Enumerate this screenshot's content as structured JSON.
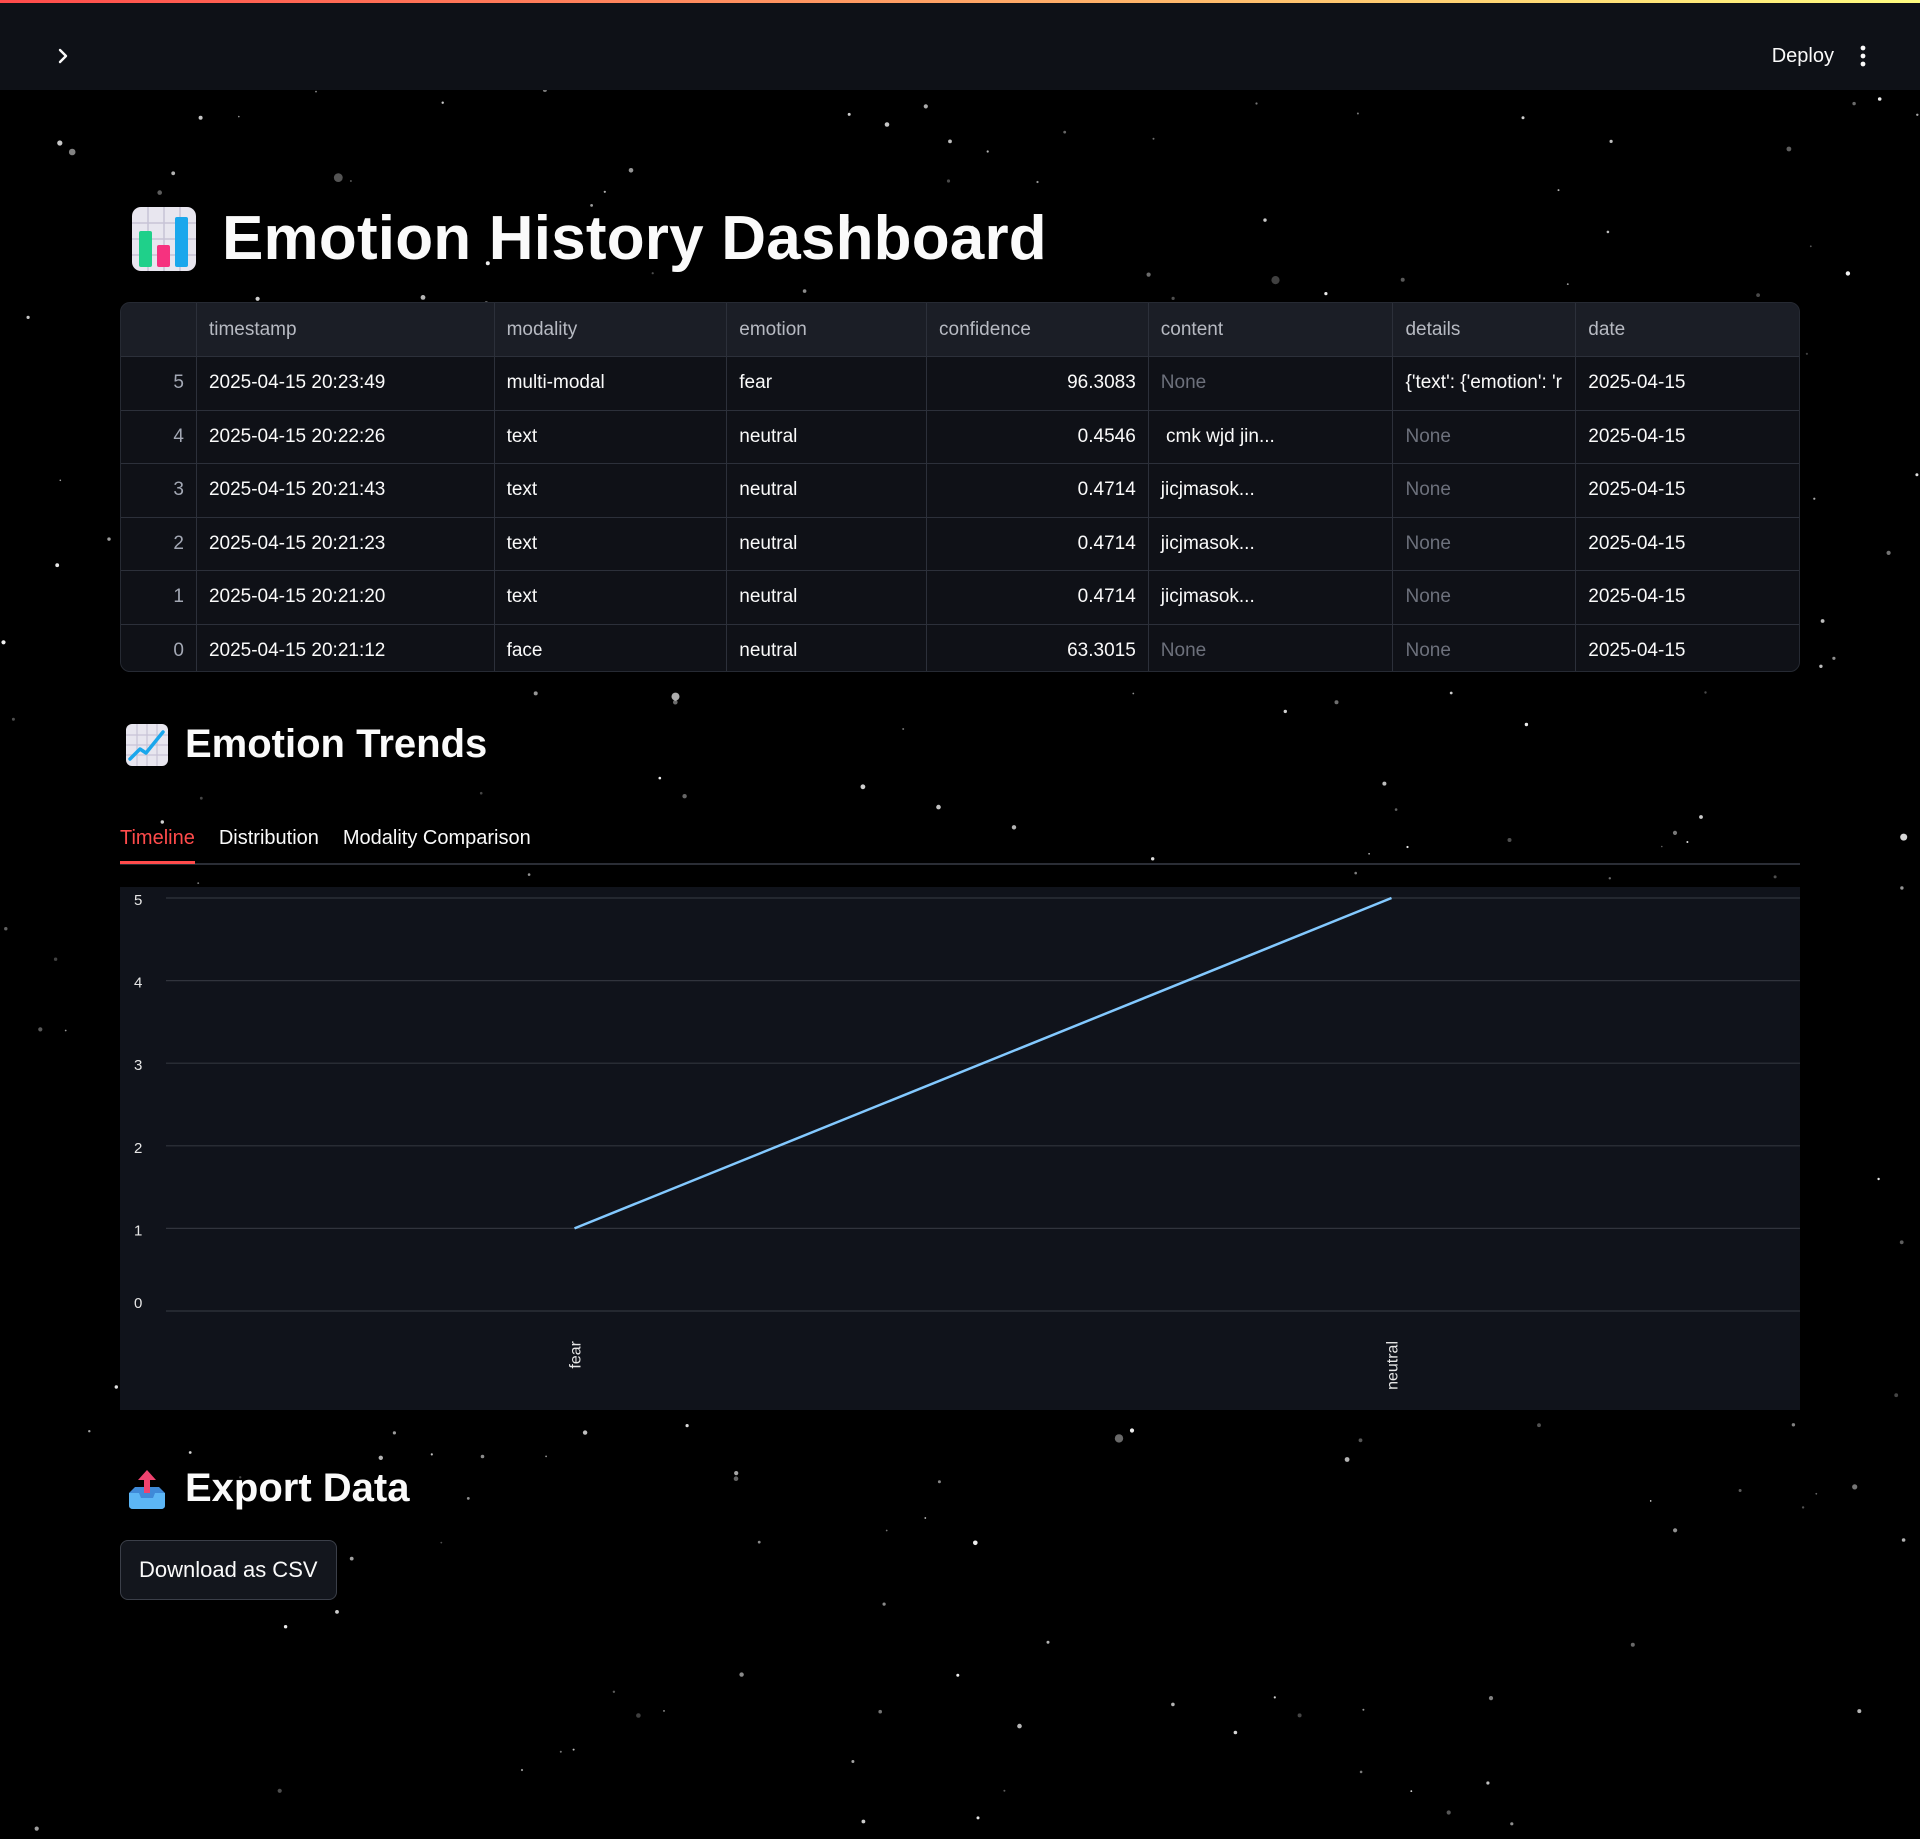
{
  "header": {
    "deploy_label": "Deploy",
    "sidebar_toggle_icon": "chevron-right-icon",
    "menu_icon": "more-vertical-icon"
  },
  "page": {
    "title": "Emotion History Dashboard",
    "title_icon": "bar-chart-emoji-icon"
  },
  "table": {
    "columns": [
      "",
      "timestamp",
      "modality",
      "emotion",
      "confidence",
      "content",
      "details",
      "date"
    ],
    "rows": [
      {
        "index": "5",
        "timestamp": "2025-04-15 20:23:49",
        "modality": "multi-modal",
        "emotion": "fear",
        "confidence": "96.3083",
        "content": "None",
        "details": "{'text': {'emotion': 'r",
        "date": "2025-04-15"
      },
      {
        "index": "4",
        "timestamp": "2025-04-15 20:22:26",
        "modality": "text",
        "emotion": "neutral",
        "confidence": "0.4546",
        "content": " cmk wjd jin...",
        "details": "None",
        "date": "2025-04-15"
      },
      {
        "index": "3",
        "timestamp": "2025-04-15 20:21:43",
        "modality": "text",
        "emotion": "neutral",
        "confidence": "0.4714",
        "content": "jicjmasok...",
        "details": "None",
        "date": "2025-04-15"
      },
      {
        "index": "2",
        "timestamp": "2025-04-15 20:21:23",
        "modality": "text",
        "emotion": "neutral",
        "confidence": "0.4714",
        "content": "jicjmasok...",
        "details": "None",
        "date": "2025-04-15"
      },
      {
        "index": "1",
        "timestamp": "2025-04-15 20:21:20",
        "modality": "text",
        "emotion": "neutral",
        "confidence": "0.4714",
        "content": "jicjmasok...",
        "details": "None",
        "date": "2025-04-15"
      },
      {
        "index": "0",
        "timestamp": "2025-04-15 20:21:12",
        "modality": "face",
        "emotion": "neutral",
        "confidence": "63.3015",
        "content": "None",
        "details": "None",
        "date": "2025-04-15"
      }
    ]
  },
  "trends": {
    "title": "Emotion Trends",
    "title_icon": "chart-increasing-emoji-icon",
    "tabs": [
      {
        "label": "Timeline",
        "active": true
      },
      {
        "label": "Distribution",
        "active": false
      },
      {
        "label": "Modality Comparison",
        "active": false
      }
    ]
  },
  "chart_data": {
    "type": "line",
    "categories": [
      "fear",
      "neutral"
    ],
    "series": [
      {
        "values": [
          1,
          5
        ],
        "color": "#83c9ff"
      }
    ],
    "ylim": [
      0,
      5
    ],
    "yticks": [
      0,
      1,
      2,
      3,
      4,
      5
    ],
    "xlabel": "",
    "ylabel": "",
    "title": "",
    "grid": true
  },
  "export": {
    "title": "Export Data",
    "title_icon": "outbox-tray-emoji-icon",
    "download_label": "Download as CSV"
  },
  "colors": {
    "background": "#000000",
    "header_bg": "#0e1117",
    "accent": "#ff4b4b",
    "line": "#83c9ff"
  }
}
